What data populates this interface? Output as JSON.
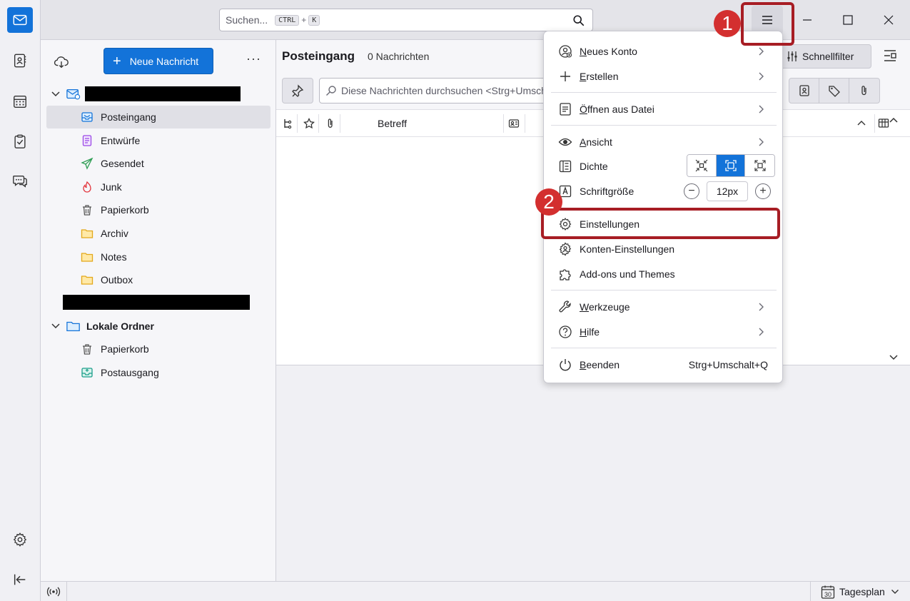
{
  "titlebar": {
    "search_placeholder": "Suchen...",
    "search_key_ctrl": "CTRL",
    "search_key_plus": "+",
    "search_key_k": "K"
  },
  "folderpane": {
    "new_message_label": "Neue Nachricht",
    "more_label": "···",
    "account1_folders": [
      {
        "label": "Posteingang",
        "icon": "inbox-icon",
        "selected": true
      },
      {
        "label": "Entwürfe",
        "icon": "drafts-icon"
      },
      {
        "label": "Gesendet",
        "icon": "sent-icon"
      },
      {
        "label": "Junk",
        "icon": "junk-icon"
      },
      {
        "label": "Papierkorb",
        "icon": "trash-icon"
      },
      {
        "label": "Archiv",
        "icon": "folder-icon"
      },
      {
        "label": "Notes",
        "icon": "folder-icon"
      },
      {
        "label": "Outbox",
        "icon": "folder-icon"
      }
    ],
    "local_account_label": "Lokale Ordner",
    "local_folders": [
      {
        "label": "Papierkorb",
        "icon": "trash-icon"
      },
      {
        "label": "Postausgang",
        "icon": "outbox-icon"
      }
    ]
  },
  "threadpane": {
    "folder_title": "Posteingang",
    "message_count": "0 Nachrichten",
    "quickfilter_label": "Schnellfilter",
    "search_placeholder": "Diese Nachrichten durchsuchen <Strg+Umschalt+K>",
    "column_subject": "Betreff"
  },
  "statusbar": {
    "today_label": "Tagesplan",
    "calendar_day": "30"
  },
  "appmenu": {
    "items": {
      "new_account": {
        "pre": "",
        "u": "N",
        "post": "eues Konto"
      },
      "create": {
        "pre": "",
        "u": "E",
        "post": "rstellen"
      },
      "open_file": {
        "pre": "",
        "u": "Ö",
        "post": "ffnen aus Datei"
      },
      "view": {
        "pre": "",
        "u": "A",
        "post": "nsicht"
      },
      "density": "Dichte",
      "font_size": "Schriftgröße",
      "font_size_value": "12px",
      "settings": "Einstellungen",
      "account_settings": "Konten-Einstellungen",
      "addons": "Add-ons und Themes",
      "tools": {
        "pre": "",
        "u": "W",
        "post": "erkzeuge"
      },
      "help": {
        "pre": "",
        "u": "H",
        "post": "ilfe"
      },
      "quit": {
        "pre": "",
        "u": "B",
        "post": "eenden"
      },
      "quit_shortcut": "Strg+Umschalt+Q"
    }
  },
  "annotations": {
    "step1": "1",
    "step2": "2"
  },
  "colors": {
    "accent": "#1373d9",
    "highlight": "#a71d24",
    "badge": "#d32f2f"
  }
}
